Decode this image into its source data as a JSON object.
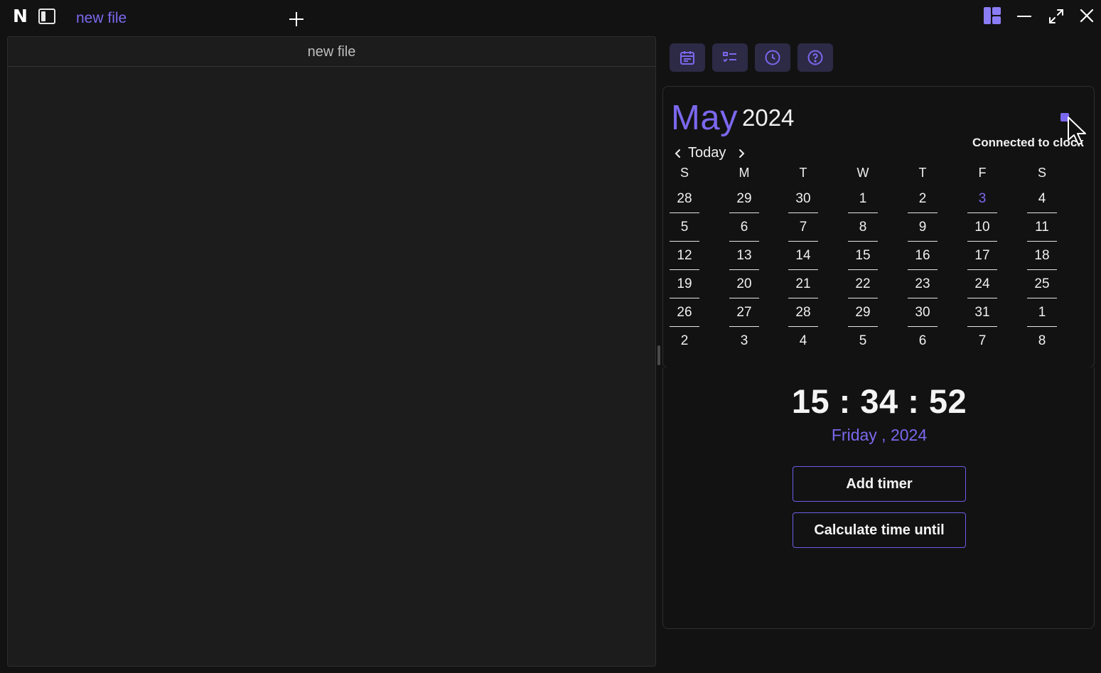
{
  "titlebar": {
    "logo": "N",
    "tab_title": "new file",
    "icons": {
      "sidebar_toggle": "sidebar-toggle-icon",
      "new_tab": "plus-icon",
      "layout": "layout-grid-icon",
      "minimize": "minimize-icon",
      "maximize": "maximize-icon",
      "close": "close-icon"
    }
  },
  "editor": {
    "header_title": "new file"
  },
  "toolbar": {
    "tools": [
      {
        "icon": "calendar-icon"
      },
      {
        "icon": "checklist-icon"
      },
      {
        "icon": "clock-icon"
      },
      {
        "icon": "help-icon"
      }
    ]
  },
  "calendar": {
    "month": "May",
    "year": "2024",
    "connected_label": "Connected to clock",
    "today_label": "Today",
    "weekdays": [
      "S",
      "M",
      "T",
      "W",
      "T",
      "F",
      "S"
    ],
    "current_day": "3",
    "weeks": [
      [
        "28",
        "29",
        "30",
        "1",
        "2",
        "3",
        "4"
      ],
      [
        "5",
        "6",
        "7",
        "8",
        "9",
        "10",
        "11"
      ],
      [
        "12",
        "13",
        "14",
        "15",
        "16",
        "17",
        "18"
      ],
      [
        "19",
        "20",
        "21",
        "22",
        "23",
        "24",
        "25"
      ],
      [
        "26",
        "27",
        "28",
        "29",
        "30",
        "31",
        "1"
      ],
      [
        "2",
        "3",
        "4",
        "5",
        "6",
        "7",
        "8"
      ]
    ]
  },
  "clock": {
    "time": "15 : 34 : 52",
    "date": "Friday , 2024",
    "add_timer_label": "Add timer",
    "calculate_label": "Calculate time until"
  },
  "colors": {
    "accent": "#7b68ee",
    "background": "#121212",
    "editor_bg": "#1c1c1c",
    "tool_bg": "#2c2a45"
  }
}
